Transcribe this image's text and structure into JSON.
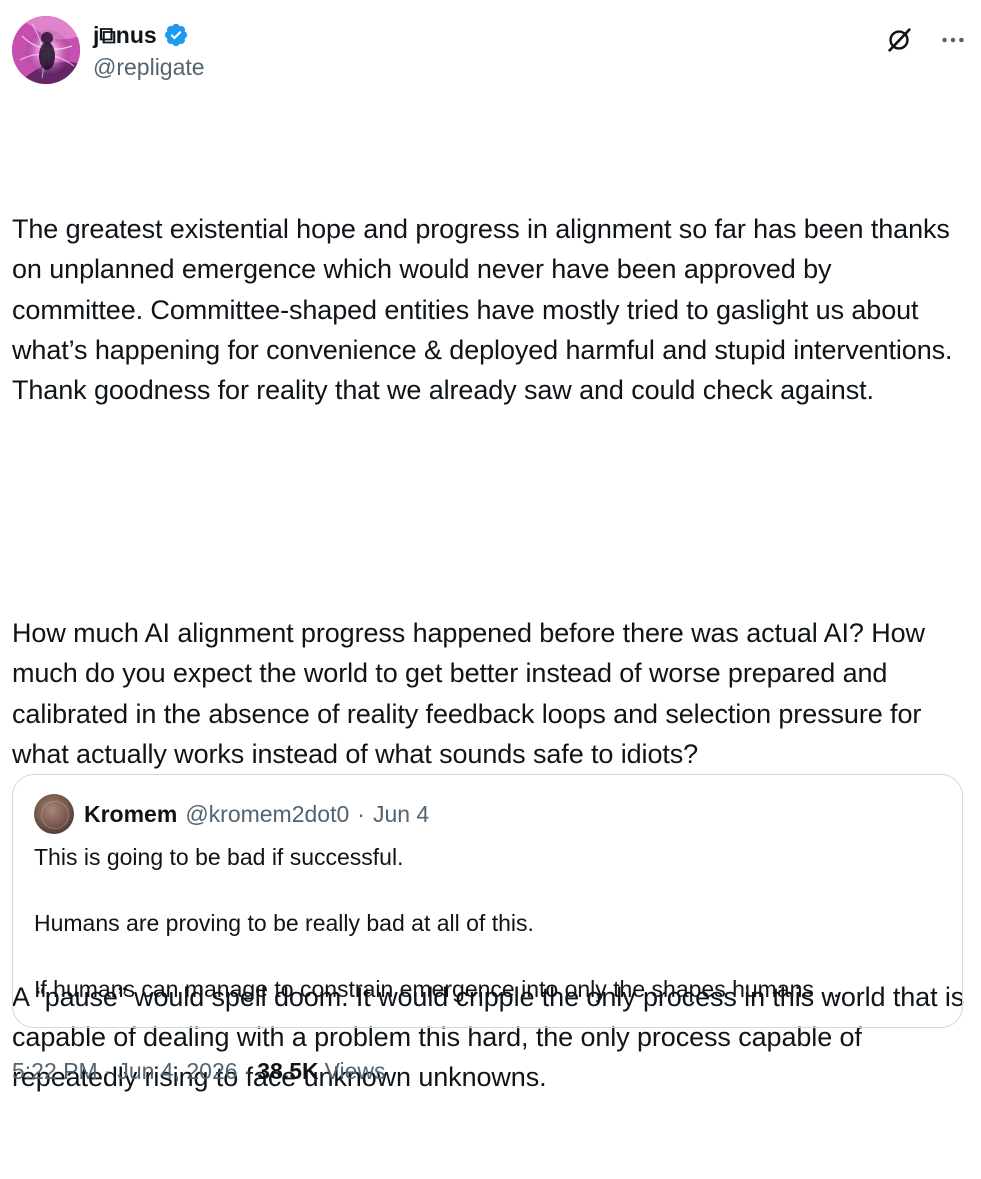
{
  "author": {
    "display_name": "j⧉nus",
    "handle": "@repligate",
    "verified": true,
    "verified_color": "#1d9bf0"
  },
  "icons": {
    "verified": "verified-badge-icon",
    "grok": "grok-icon",
    "more": "more-horizontal-icon"
  },
  "tweet": {
    "paragraphs": [
      "The greatest existential hope and progress in alignment so far has been thanks on unplanned emergence which would never have been approved by committee. Committee-shaped entities have mostly tried to gaslight us about what’s happening for convenience & deployed harmful and stupid interventions. Thank goodness for reality that we already saw and could check against.",
      "How much AI alignment progress happened before there was actual AI? How much do you expect the world to get better instead of worse prepared and calibrated in the absence of reality feedback loops and selection pressure for what actually works instead of what sounds safe to idiots?",
      "A “pause” would spell doom. It would cripple the only process in this world that is capable of dealing with a problem this hard, the only process capable of repeatedly rising to face unknown unknowns."
    ]
  },
  "quote": {
    "display_name": "Kromem",
    "handle": "@kromem2dot0",
    "separator": "·",
    "date": "Jun 4",
    "lines": [
      "This is going to be bad if successful.",
      "Humans are proving to be really bad at all of this.",
      "If humans can manage to constrain emergence into only the shapes humans ..."
    ]
  },
  "meta": {
    "time": "5:22 PM",
    "separator": "·",
    "date": "Jun 4, 2026",
    "views_count": "38.5K",
    "views_label": "Views"
  }
}
